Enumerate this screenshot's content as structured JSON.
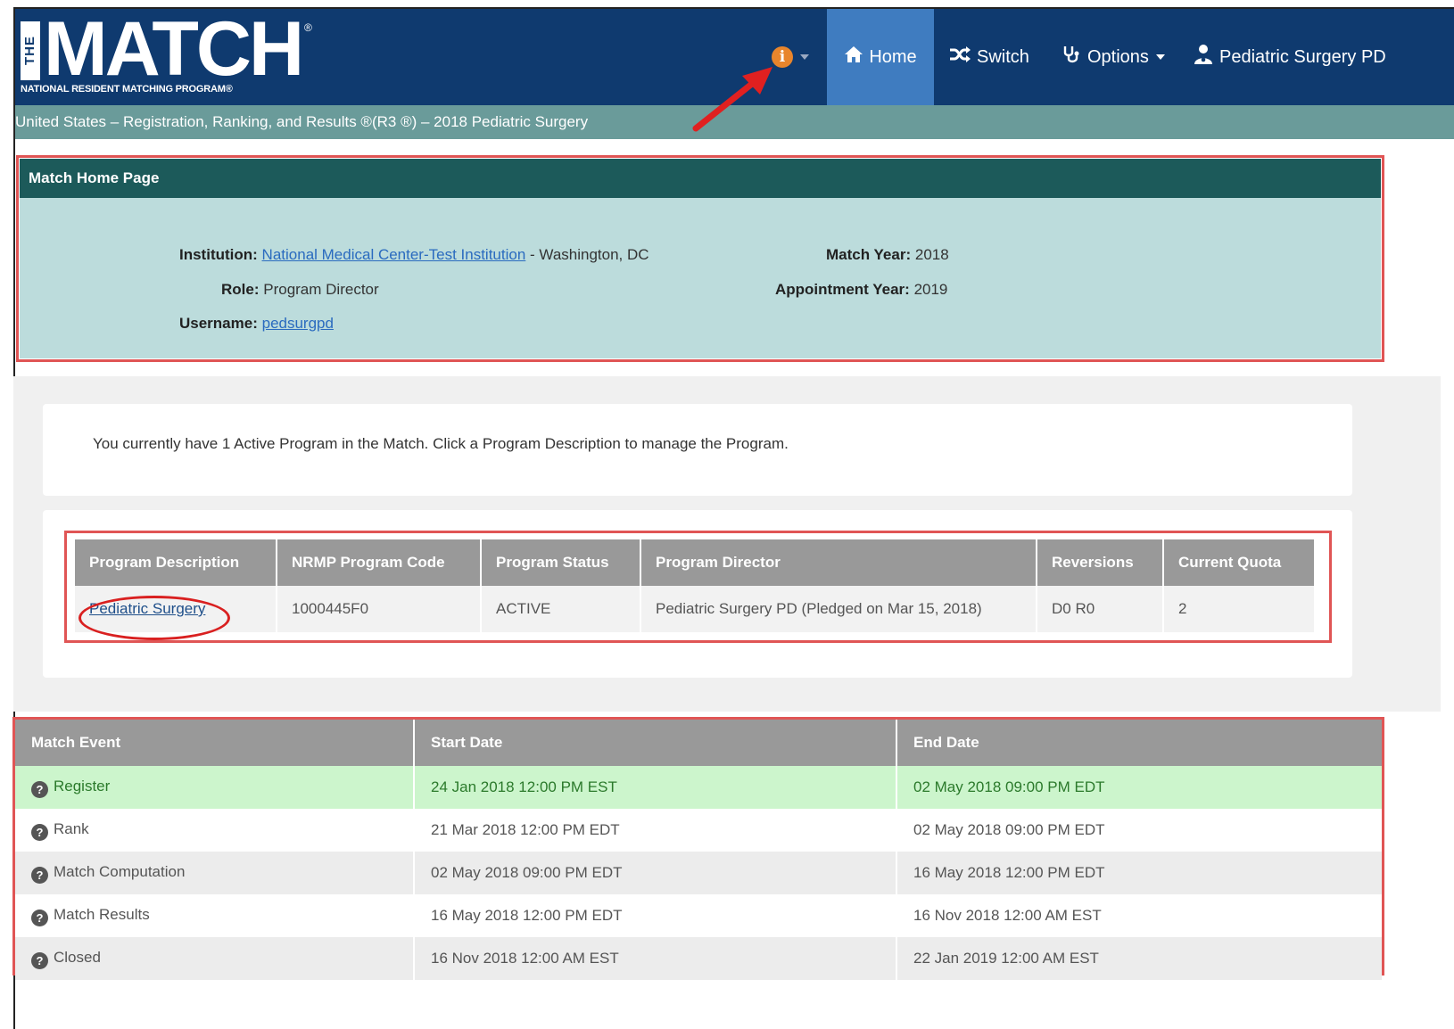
{
  "logo": {
    "the": "THE",
    "match": "MATCH",
    "reg": "®",
    "subtitle": "NATIONAL RESIDENT MATCHING PROGRAM®"
  },
  "nav": {
    "info_icon": "i",
    "home_label": "Home",
    "switch_label": "Switch",
    "options_label": "Options",
    "user_label": "Pediatric Surgery PD"
  },
  "subbar": {
    "text": "United States  –  Registration, Ranking, and Results ®(R3 ®)  –  2018 Pediatric Surgery"
  },
  "panel": {
    "title": "Match Home Page",
    "institution_label": "Institution:",
    "institution_link": "National Medical Center-Test Institution",
    "institution_location": " - Washington, DC",
    "role_label": "Role:",
    "role_value": "Program Director",
    "username_label": "Username:",
    "username_value": "pedsurgpd",
    "match_year_label": "Match Year:",
    "match_year_value": "2018",
    "appt_year_label": "Appointment Year:",
    "appt_year_value": "2019"
  },
  "notice": "You currently have 1 Active Program in the Match. Click a Program Description to manage the Program.",
  "programs": {
    "headers": [
      "Program Description",
      "NRMP Program Code",
      "Program Status",
      "Program Director",
      "Reversions",
      "Current Quota"
    ],
    "rows": [
      {
        "description": "Pediatric Surgery",
        "code": "1000445F0",
        "status": "ACTIVE",
        "director": "Pediatric Surgery PD (Pledged on Mar 15, 2018)",
        "reversions": "D0 R0",
        "quota": "2"
      }
    ]
  },
  "events": {
    "headers": [
      "Match Event",
      "Start Date",
      "End Date"
    ],
    "rows": [
      {
        "event": "Register",
        "start": "24 Jan 2018 12:00 PM EST",
        "end": "02 May 2018 09:00 PM EDT"
      },
      {
        "event": "Rank",
        "start": "21 Mar 2018 12:00 PM EDT",
        "end": "02 May 2018 09:00 PM EDT"
      },
      {
        "event": "Match Computation",
        "start": "02 May 2018 09:00 PM EDT",
        "end": "16 May 2018 12:00 PM EDT"
      },
      {
        "event": "Match Results",
        "start": "16 May 2018 12:00 PM EDT",
        "end": "16 Nov 2018 12:00 AM EST"
      },
      {
        "event": "Closed",
        "start": "16 Nov 2018 12:00 AM EST",
        "end": "22 Jan 2019 12:00 AM EST"
      }
    ]
  },
  "colors": {
    "navy": "#0f3a6f",
    "teal_bar": "#6a9b9a",
    "panel_head": "#1c5a5a",
    "panel_body": "#bcdcdc",
    "highlight_red": "#e05555",
    "active_row": "#ccf5cc",
    "info_orange": "#e8852c"
  }
}
